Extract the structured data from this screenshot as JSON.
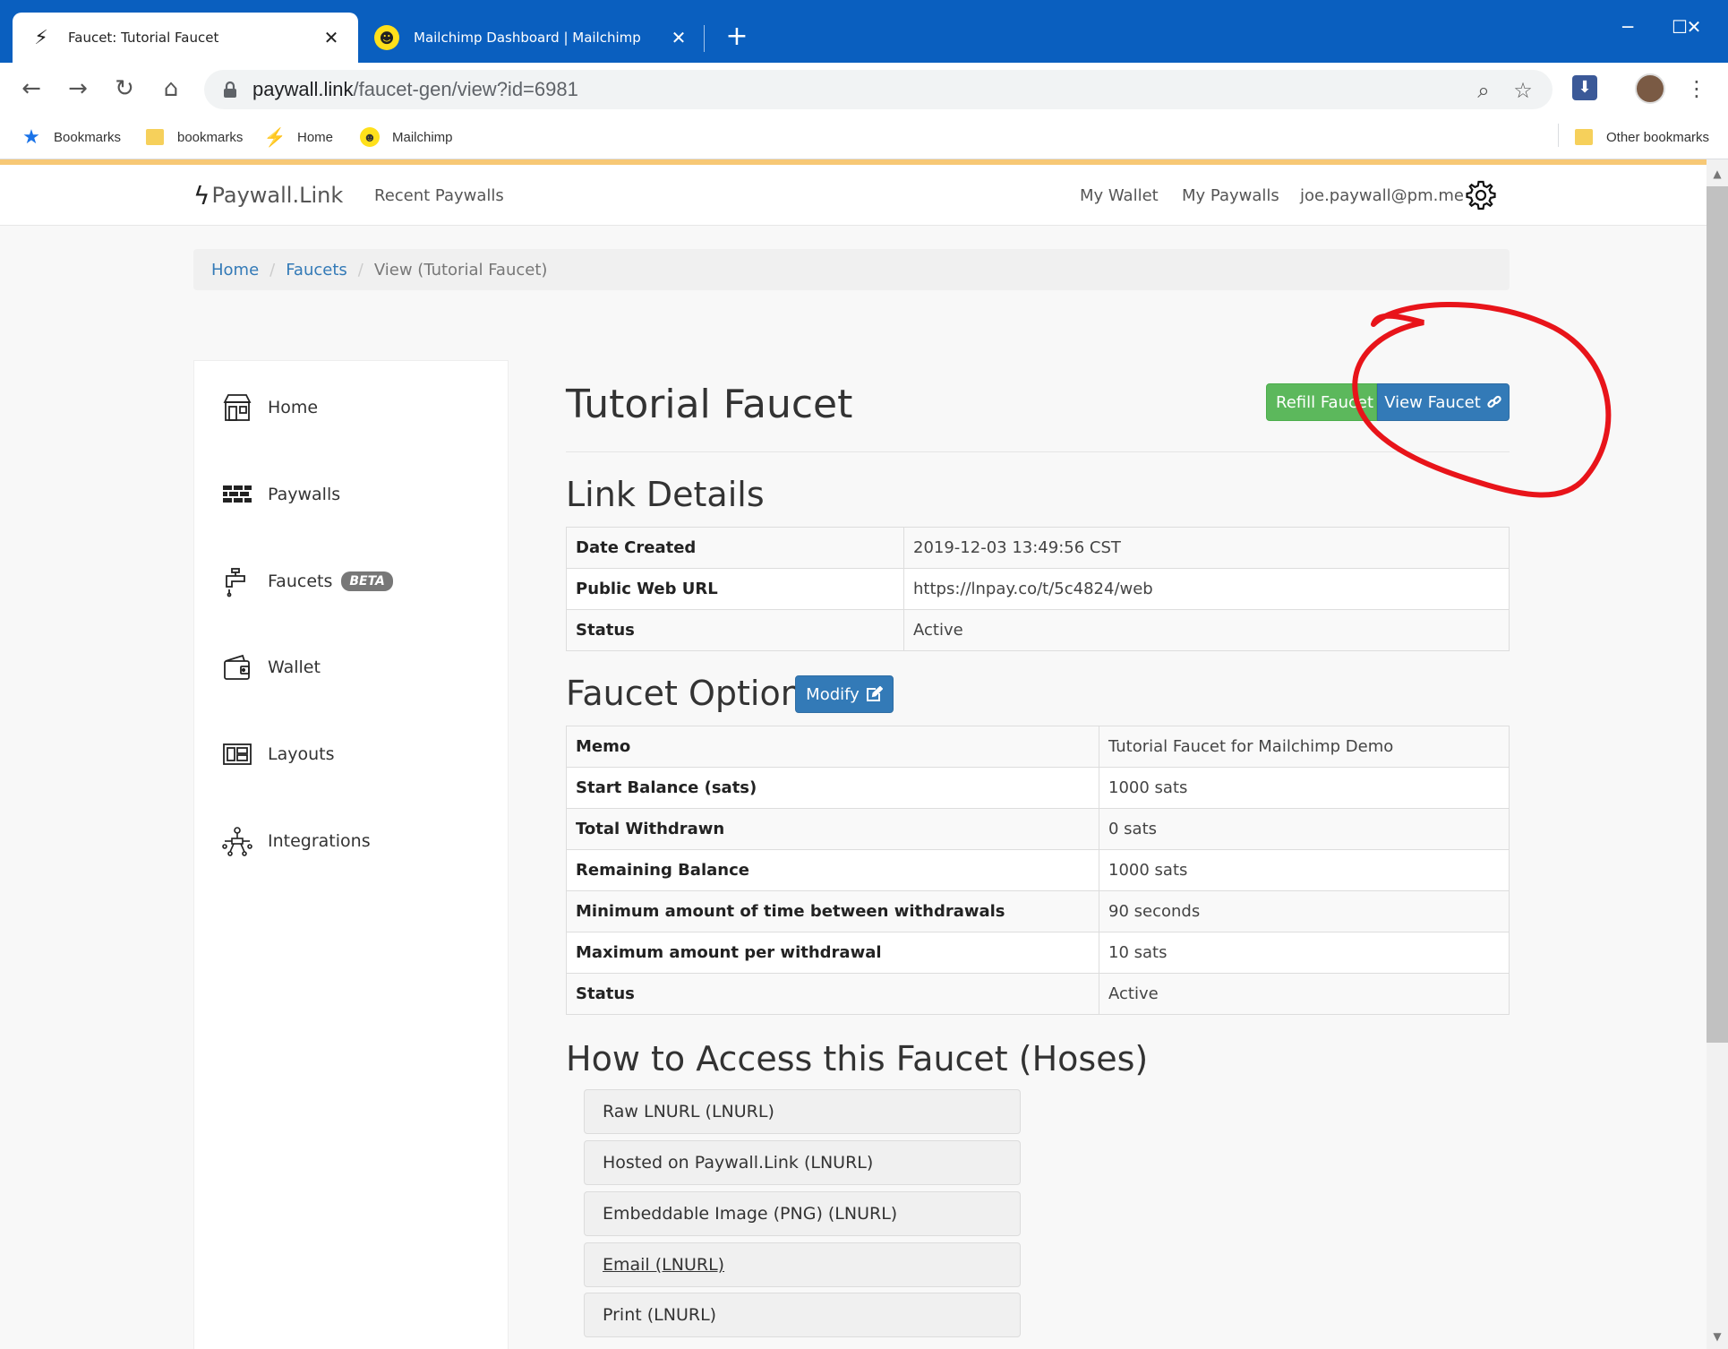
{
  "browser": {
    "tabs": [
      {
        "title": "Faucet: Tutorial Faucet",
        "icon": "paywall-favicon",
        "active": true
      },
      {
        "title": "Mailchimp Dashboard | Mailchimp",
        "icon": "mailchimp-favicon",
        "active": false
      }
    ],
    "url_host": "paywall.link",
    "url_path": "/faucet-gen/view?id=6981",
    "bookmarks": [
      {
        "label": "Bookmarks",
        "icon": "star-icon"
      },
      {
        "label": "bookmarks",
        "icon": "folder-icon"
      },
      {
        "label": "Home",
        "icon": "paywall-favicon"
      },
      {
        "label": "Mailchimp",
        "icon": "mailchimp-favicon"
      }
    ],
    "other_bookmarks": "Other bookmarks"
  },
  "navbar": {
    "brand": "Paywall.Link",
    "recent": "Recent Paywalls",
    "wallet": "My Wallet",
    "paywalls": "My Paywalls",
    "user": "joe.paywall@pm.me"
  },
  "breadcrumb": {
    "home": "Home",
    "faucets": "Faucets",
    "current": "View (Tutorial Faucet)"
  },
  "sidebar": {
    "items": [
      {
        "label": "Home",
        "icon": "storefront-icon"
      },
      {
        "label": "Paywalls",
        "icon": "brick-wall-icon"
      },
      {
        "label": "Faucets",
        "icon": "faucet-icon",
        "badge": "BETA"
      },
      {
        "label": "Wallet",
        "icon": "wallet-icon"
      },
      {
        "label": "Layouts",
        "icon": "layout-icon"
      },
      {
        "label": "Integrations",
        "icon": "integrations-icon"
      }
    ]
  },
  "main": {
    "title": "Tutorial Faucet",
    "refill_label": "Refill Faucet",
    "view_label": "View Faucet",
    "link_details_heading": "Link Details",
    "link_details": [
      {
        "key": "Date Created",
        "value": "2019-12-03 13:49:56 CST"
      },
      {
        "key": "Public Web URL",
        "value": "https://lnpay.co/t/5c4824/web"
      },
      {
        "key": "Status",
        "value": "Active"
      }
    ],
    "options_heading": "Faucet Options",
    "modify_label": "Modify",
    "options": [
      {
        "key": "Memo",
        "value": "Tutorial Faucet for Mailchimp Demo"
      },
      {
        "key": "Start Balance (sats)",
        "value": "1000 sats"
      },
      {
        "key": "Total Withdrawn",
        "value": "0 sats"
      },
      {
        "key": "Remaining Balance",
        "value": "1000 sats"
      },
      {
        "key": "Minimum amount of time between withdrawals",
        "value": "90 seconds"
      },
      {
        "key": "Maximum amount per withdrawal",
        "value": "10 sats"
      },
      {
        "key": "Status",
        "value": "Active"
      }
    ],
    "hoses_heading": "How to Access this Faucet (Hoses)",
    "hoses": [
      "Raw LNURL (LNURL)",
      "Hosted on Paywall.Link (LNURL)",
      "Embeddable Image (PNG) (LNURL)",
      "Email (LNURL)",
      "Print (LNURL)"
    ]
  },
  "colors": {
    "chrome_blue": "#0a5fbf",
    "accent_orange": "#f7c875",
    "btn_green": "#5cb85c",
    "btn_blue": "#337ab7",
    "annotation_red": "#e8141a"
  }
}
